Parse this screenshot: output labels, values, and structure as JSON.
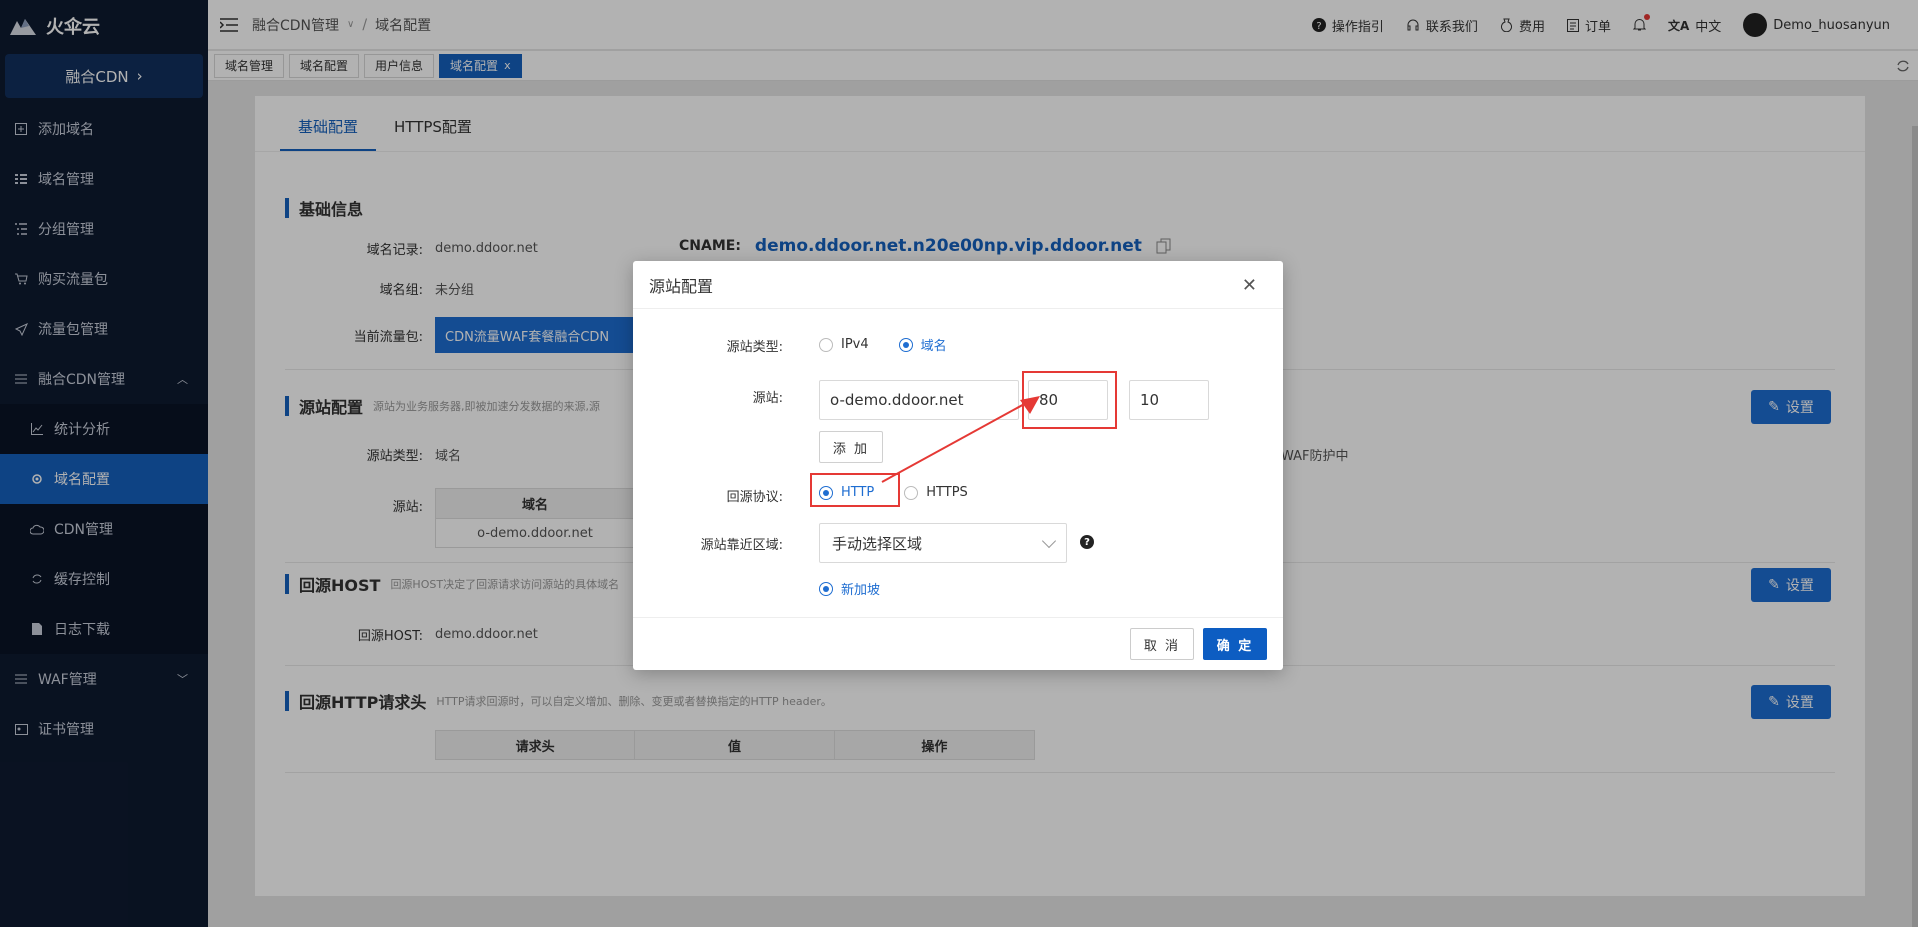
{
  "brand": {
    "name": "火伞云"
  },
  "sidebar": {
    "product": "融合CDN",
    "items": [
      {
        "label": "添加域名",
        "icon": "plus-square-icon"
      },
      {
        "label": "域名管理",
        "icon": "list-icon"
      },
      {
        "label": "分组管理",
        "icon": "group-list-icon"
      },
      {
        "label": "购买流量包",
        "icon": "cart-icon"
      },
      {
        "label": "流量包管理",
        "icon": "send-icon"
      },
      {
        "label": "融合CDN管理",
        "icon": "menu-icon"
      },
      {
        "label": "统计分析",
        "icon": "chart-icon"
      },
      {
        "label": "域名配置",
        "icon": "gear-icon"
      },
      {
        "label": "CDN管理",
        "icon": "cloud-icon"
      },
      {
        "label": "缓存控制",
        "icon": "refresh-icon"
      },
      {
        "label": "日志下载",
        "icon": "file-icon"
      },
      {
        "label": "WAF管理",
        "icon": "menu-icon"
      },
      {
        "label": "证书管理",
        "icon": "cert-icon"
      }
    ]
  },
  "topbar": {
    "breadcrumb": [
      "融合CDN管理",
      "域名配置"
    ],
    "guide": "操作指引",
    "contact": "联系我们",
    "billing": "费用",
    "orders": "订单",
    "language": "中文",
    "username": "Demo_huosanyun"
  },
  "tabs": [
    "域名管理",
    "域名配置",
    "用户信息",
    "域名配置"
  ],
  "content": {
    "tabs": [
      "基础配置",
      "HTTPS配置"
    ],
    "basic_info": {
      "title": "基础信息",
      "domain_record_label": "域名记录:",
      "domain_record": "demo.ddoor.net",
      "cname_label": "CNAME:",
      "cname": "demo.ddoor.net.n20e00np.vip.ddoor.net",
      "group_label": "域名组:",
      "group": "未分组",
      "package_label": "当前流量包:",
      "package": "CDN流量WAF套餐融合CDN"
    },
    "origin": {
      "title": "源站配置",
      "desc": "源站为业务服务器,即被加速分发数据的来源,源",
      "type_label": "源站类型:",
      "type": "域名",
      "origin_label": "源站:",
      "table_header": "域名",
      "table_value": "o-demo.ddoor.net",
      "waf_note": "WAF防护中"
    },
    "host": {
      "title": "回源HOST",
      "desc": "回源HOST决定了回源请求访问源站的具体域名",
      "label": "回源HOST:",
      "value": "demo.ddoor.net"
    },
    "headers": {
      "title": "回源HTTP请求头",
      "desc": "HTTP请求回源时，可以自定义增加、删除、变更或者替换指定的HTTP header。",
      "cols": [
        "请求头",
        "值",
        "操作"
      ]
    },
    "set_label": "设置"
  },
  "modal": {
    "title": "源站配置",
    "type_label": "源站类型:",
    "type_options": [
      "IPv4",
      "域名"
    ],
    "origin_label": "源站:",
    "origin_value": "o-demo.ddoor.net",
    "port_value": "80",
    "weight_value": "10",
    "add_label": "添 加",
    "protocol_label": "回源协议:",
    "protocol_options": [
      "HTTP",
      "HTTPS"
    ],
    "region_label": "源站靠近区域:",
    "region_value": "手动选择区域",
    "region_choice": "新加坡",
    "cancel": "取 消",
    "ok": "确 定"
  },
  "colors": {
    "accent": "#1560bd",
    "sidebar": "#0e1a30",
    "highlight": "#e53935"
  }
}
